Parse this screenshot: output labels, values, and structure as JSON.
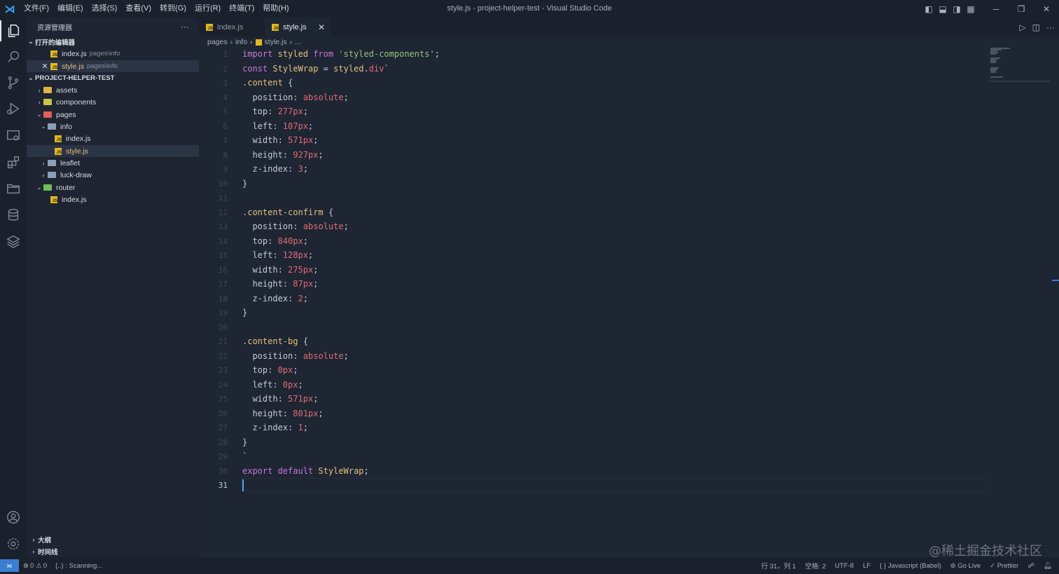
{
  "titlebar": {
    "title": "style.js - project-helper-test - Visual Studio Code",
    "menus": [
      "文件(F)",
      "编辑(E)",
      "选择(S)",
      "查看(V)",
      "转到(G)",
      "运行(R)",
      "终端(T)",
      "帮助(H)"
    ],
    "logo_icon": "vscode-logo-icon"
  },
  "activity_bar": {
    "items": [
      "explorer-icon",
      "search-icon",
      "source-control-icon",
      "run-debug-icon",
      "remote-explorer-icon",
      "extensions-icon",
      "folder-manager-icon",
      "database-icon",
      "layers-icon"
    ],
    "bottom": [
      "account-icon",
      "settings-gear-icon"
    ]
  },
  "sidebar": {
    "title": "资源管理器",
    "more": "···",
    "open_editors_label": "打开的编辑器",
    "open_editors": [
      {
        "name": "index.js",
        "path": "pages\\info"
      },
      {
        "name": "style.js",
        "path": "pages\\info",
        "close": "✕"
      }
    ],
    "project_label": "PROJECT-HELPER-TEST",
    "tree": [
      {
        "name": "assets"
      },
      {
        "name": "components"
      },
      {
        "name": "pages"
      },
      {
        "name": "info"
      },
      {
        "name": "index.js"
      },
      {
        "name": "style.js"
      },
      {
        "name": "leaflet"
      },
      {
        "name": "luck-draw"
      },
      {
        "name": "router"
      },
      {
        "name": "index.js"
      }
    ],
    "outline_label": "大纲",
    "timeline_label": "时间线"
  },
  "tabs": [
    {
      "label": "index.js"
    },
    {
      "label": "style.js",
      "close": "✕"
    }
  ],
  "breadcrumb": {
    "parts": [
      "pages",
      "info",
      "style.js",
      "..."
    ]
  },
  "editor": {
    "current_line": 31,
    "line_numbers": [
      "1",
      "2",
      "3",
      "4",
      "5",
      "6",
      "7",
      "8",
      "9",
      "10",
      "11",
      "12",
      "13",
      "14",
      "15",
      "16",
      "17",
      "18",
      "19",
      "20",
      "21",
      "22",
      "23",
      "24",
      "25",
      "26",
      "27",
      "28",
      "29",
      "30",
      "31"
    ],
    "lines": [
      [
        [
          "kw",
          "import "
        ],
        [
          "id",
          "styled "
        ],
        [
          "kw",
          "from "
        ],
        [
          "str",
          "'styled-components'"
        ],
        [
          "prop",
          ";"
        ]
      ],
      [
        [
          "kw",
          "const "
        ],
        [
          "id",
          "StyleWrap"
        ],
        [
          "prop",
          " = "
        ],
        [
          "id",
          "styled"
        ],
        [
          "prop",
          "."
        ],
        [
          "val",
          "div"
        ],
        [
          "prop",
          "`"
        ]
      ],
      [
        [
          "sel",
          ".content"
        ],
        [
          "prop",
          " {"
        ]
      ],
      [
        [
          "prop",
          "  position: "
        ],
        [
          "val",
          "absolute"
        ],
        [
          "prop",
          ";"
        ]
      ],
      [
        [
          "prop",
          "  top: "
        ],
        [
          "num",
          "277px"
        ],
        [
          "prop",
          ";"
        ]
      ],
      [
        [
          "prop",
          "  left: "
        ],
        [
          "num",
          "107px"
        ],
        [
          "prop",
          ";"
        ]
      ],
      [
        [
          "prop",
          "  width: "
        ],
        [
          "num",
          "571px"
        ],
        [
          "prop",
          ";"
        ]
      ],
      [
        [
          "prop",
          "  height: "
        ],
        [
          "num",
          "927px"
        ],
        [
          "prop",
          ";"
        ]
      ],
      [
        [
          "prop",
          "  z-index: "
        ],
        [
          "num",
          "3"
        ],
        [
          "prop",
          ";"
        ]
      ],
      [
        [
          "prop",
          "}"
        ]
      ],
      [],
      [
        [
          "sel",
          ".content-confirm"
        ],
        [
          "prop",
          " {"
        ]
      ],
      [
        [
          "prop",
          "  position: "
        ],
        [
          "val",
          "absolute"
        ],
        [
          "prop",
          ";"
        ]
      ],
      [
        [
          "prop",
          "  top: "
        ],
        [
          "num",
          "840px"
        ],
        [
          "prop",
          ";"
        ]
      ],
      [
        [
          "prop",
          "  left: "
        ],
        [
          "num",
          "128px"
        ],
        [
          "prop",
          ";"
        ]
      ],
      [
        [
          "prop",
          "  width: "
        ],
        [
          "num",
          "275px"
        ],
        [
          "prop",
          ";"
        ]
      ],
      [
        [
          "prop",
          "  height: "
        ],
        [
          "num",
          "87px"
        ],
        [
          "prop",
          ";"
        ]
      ],
      [
        [
          "prop",
          "  z-index: "
        ],
        [
          "num",
          "2"
        ],
        [
          "prop",
          ";"
        ]
      ],
      [
        [
          "prop",
          "}"
        ]
      ],
      [],
      [
        [
          "sel",
          ".content-bg"
        ],
        [
          "prop",
          " {"
        ]
      ],
      [
        [
          "prop",
          "  position: "
        ],
        [
          "val",
          "absolute"
        ],
        [
          "prop",
          ";"
        ]
      ],
      [
        [
          "prop",
          "  top: "
        ],
        [
          "num",
          "0px"
        ],
        [
          "prop",
          ";"
        ]
      ],
      [
        [
          "prop",
          "  left: "
        ],
        [
          "num",
          "0px"
        ],
        [
          "prop",
          ";"
        ]
      ],
      [
        [
          "prop",
          "  width: "
        ],
        [
          "num",
          "571px"
        ],
        [
          "prop",
          ";"
        ]
      ],
      [
        [
          "prop",
          "  height: "
        ],
        [
          "num",
          "801px"
        ],
        [
          "prop",
          ";"
        ]
      ],
      [
        [
          "prop",
          "  z-index: "
        ],
        [
          "num",
          "1"
        ],
        [
          "prop",
          ";"
        ]
      ],
      [
        [
          "prop",
          "}"
        ]
      ],
      [
        [
          "prop",
          "`"
        ]
      ],
      [
        [
          "kw",
          "export "
        ],
        [
          "kw",
          "default "
        ],
        [
          "id",
          "StyleWrap"
        ],
        [
          "prop",
          ";"
        ]
      ],
      []
    ]
  },
  "statusbar": {
    "remote_icon": "remote-icon",
    "errors": "0",
    "warnings": "0",
    "scanning": "{..} : Scanning...",
    "position": "行 31，列 1",
    "spaces": "空格: 2",
    "encoding": "UTF-8",
    "eol": "LF",
    "language": "Javascript (Babel)",
    "golive": "Go Live",
    "prettier": "Prettier"
  },
  "watermark": "@稀土掘金技术社区",
  "colors": {
    "keyword": "#c678dd",
    "identifier": "#e5c07b",
    "string": "#98c379",
    "number": "#e06c75",
    "accent": "#3a7fd2"
  }
}
